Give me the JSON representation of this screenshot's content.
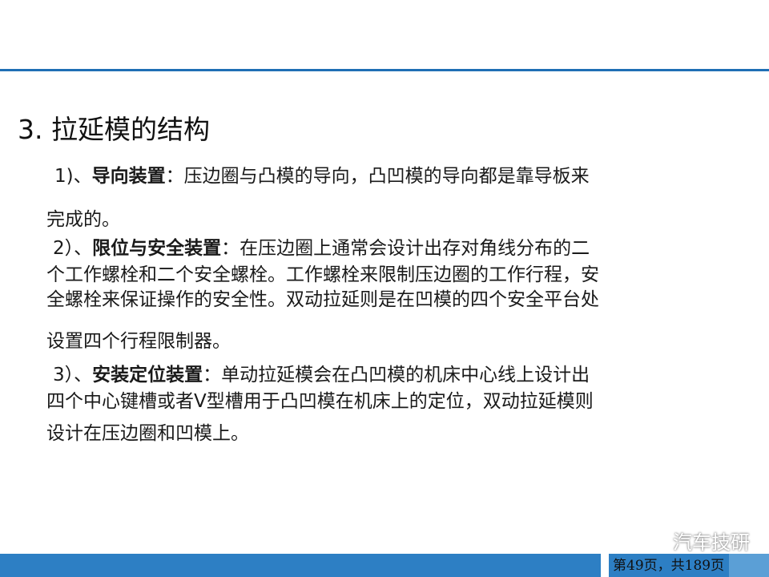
{
  "slide": {
    "title": "3. 拉延模的结构",
    "sections": [
      {
        "lead": "1)、",
        "heading": "导向装置",
        "colon": "：",
        "lines": [
          "压边圈与凸模的导向，凸凹模的导向都是靠导板来",
          "完成的。"
        ]
      },
      {
        "lead": "2）、",
        "heading": "限位与安全装置",
        "colon": "：",
        "lines": [
          "在压边圈上通常会设计出存对角线分布的二",
          "个工作螺栓和二个安全螺栓。工作螺栓来限制压边圈的工作行程，安",
          "全螺栓来保证操作的安全性。双动拉延则是在凹模的四个安全平台处",
          "设置四个行程限制器。"
        ]
      },
      {
        "lead": "3）、",
        "heading": "安装定位装置",
        "colon": "：",
        "lines": [
          "单动拉延模会在凸凹模的机床中心线上设计出",
          "四个中心键槽或者V型槽用于凸凹模在机床上的定位，双动拉延模则",
          "设计在压边圈和凹模上。"
        ]
      }
    ]
  },
  "footer": {
    "page_label": "第49页，共189页",
    "watermark": {
      "text": "汽车技研",
      "icon": "wechat-icon"
    },
    "colors": {
      "bar": "#2d7fc4",
      "accent": "#5b9fd6",
      "rule": "#1f6fb5"
    }
  }
}
